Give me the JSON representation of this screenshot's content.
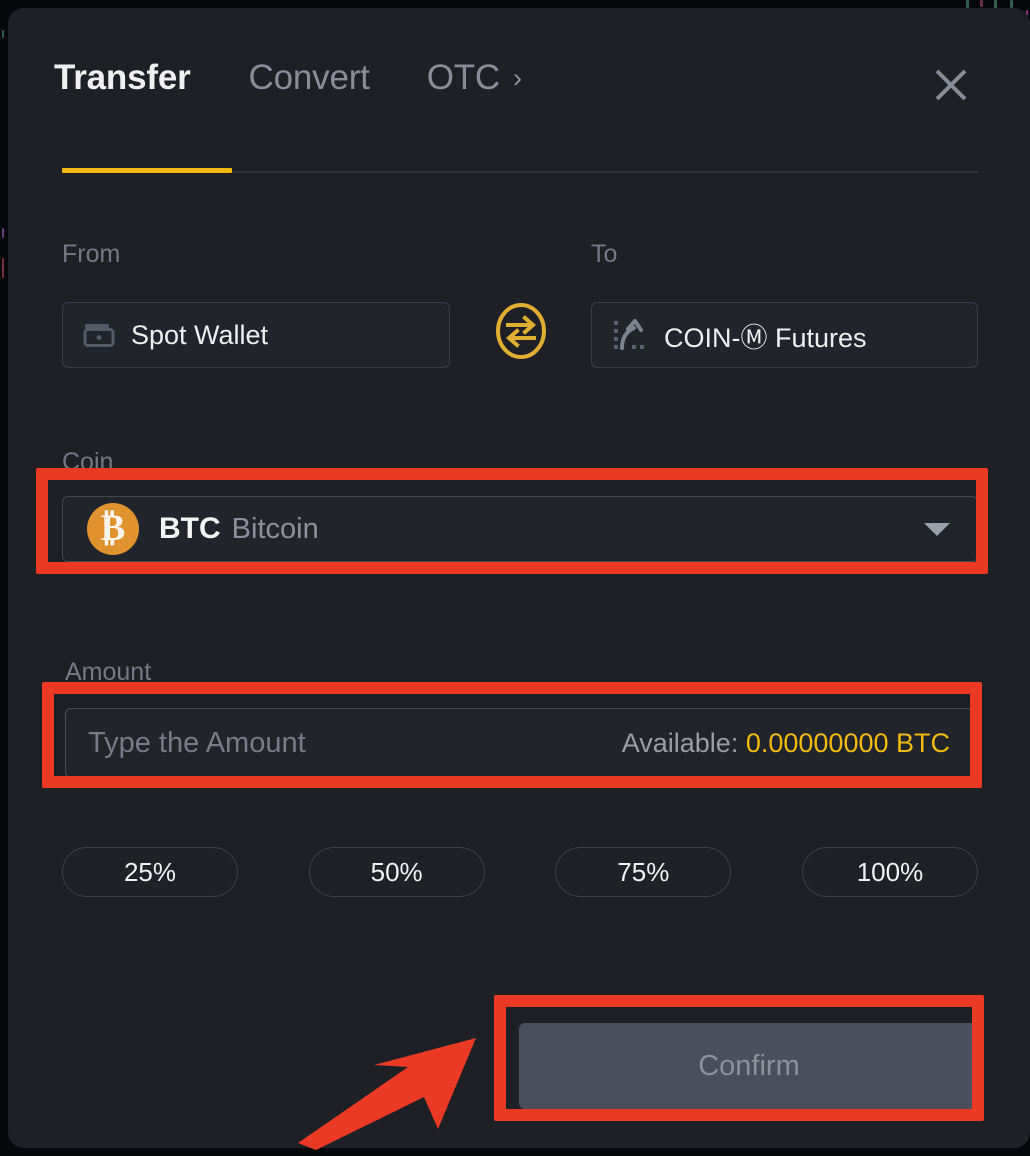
{
  "panel": {
    "name": "Transfer dialog",
    "tabs": [
      {
        "label": "Transfer",
        "active": true
      },
      {
        "label": "Convert",
        "active": false
      },
      {
        "label": "OTC",
        "active": false
      }
    ],
    "otc_chevron": "›",
    "close_icon": "close-icon"
  },
  "from": {
    "label": "From",
    "wallet": "Spot Wallet",
    "icon": "wallet-icon"
  },
  "to": {
    "label": "To",
    "wallet": "COIN-Ⓜ Futures",
    "icon": "futures-chart-icon"
  },
  "swap": {
    "icon": "swap-arrows-icon"
  },
  "coin": {
    "label": "Coin",
    "symbol": "BTC",
    "name": "Bitcoin",
    "badge_glyph": "₿",
    "badge_color": "#e0922f",
    "caret_icon": "chevron-down-icon"
  },
  "amount": {
    "label": "Amount",
    "value": "",
    "placeholder": "Type the Amount",
    "available_label": "Available:",
    "available_value": "0.00000000 BTC",
    "available_color": "#f0b90b"
  },
  "percent_buttons": [
    {
      "label": "25%"
    },
    {
      "label": "50%"
    },
    {
      "label": "75%"
    },
    {
      "label": "100%"
    }
  ],
  "confirm": {
    "label": "Confirm",
    "enabled": false
  },
  "annotations": {
    "highlight_color": "#ea3a24",
    "boxes": [
      "coin-selector",
      "amount-input",
      "confirm-button"
    ],
    "arrow": "points at confirm button"
  },
  "theme": {
    "panel_bg": "#1e2026",
    "page_bg": "#07080b",
    "accent": "#f0b90b",
    "text_primary": "#eceef1",
    "text_muted": "#8a8d99"
  }
}
